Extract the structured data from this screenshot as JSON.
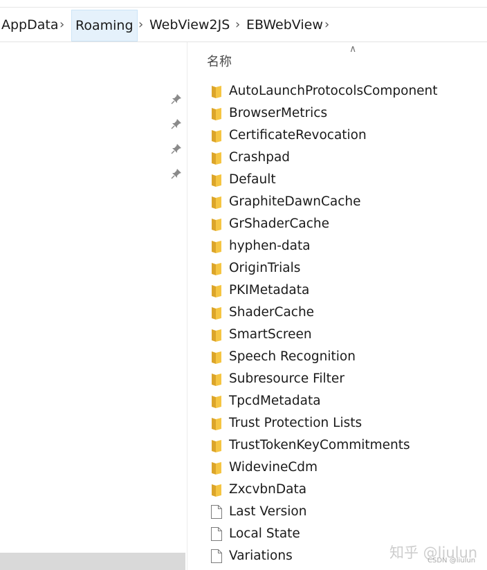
{
  "breadcrumb": {
    "items": [
      {
        "label": "AppData"
      },
      {
        "label": "Roaming"
      },
      {
        "label": "WebView2JS"
      },
      {
        "label": "EBWebView"
      }
    ],
    "separator_icon": "chevron-right-icon"
  },
  "nav_pane": {
    "pin_icon": "pin-icon",
    "pinned_count": 4
  },
  "content": {
    "sort_indicator_icon": "sort-ascending-icon",
    "column_header": "名称",
    "items": [
      {
        "name": "AutoLaunchProtocolsComponent",
        "type": "folder"
      },
      {
        "name": "BrowserMetrics",
        "type": "folder"
      },
      {
        "name": "CertificateRevocation",
        "type": "folder"
      },
      {
        "name": "Crashpad",
        "type": "folder"
      },
      {
        "name": "Default",
        "type": "folder"
      },
      {
        "name": "GraphiteDawnCache",
        "type": "folder"
      },
      {
        "name": "GrShaderCache",
        "type": "folder"
      },
      {
        "name": "hyphen-data",
        "type": "folder"
      },
      {
        "name": "OriginTrials",
        "type": "folder"
      },
      {
        "name": "PKIMetadata",
        "type": "folder"
      },
      {
        "name": "ShaderCache",
        "type": "folder"
      },
      {
        "name": "SmartScreen",
        "type": "folder"
      },
      {
        "name": "Speech Recognition",
        "type": "folder"
      },
      {
        "name": "Subresource Filter",
        "type": "folder"
      },
      {
        "name": "TpcdMetadata",
        "type": "folder"
      },
      {
        "name": "Trust Protection Lists",
        "type": "folder"
      },
      {
        "name": "TrustTokenKeyCommitments",
        "type": "folder"
      },
      {
        "name": "WidevineCdm",
        "type": "folder"
      },
      {
        "name": "ZxcvbnData",
        "type": "folder"
      },
      {
        "name": "Last Version",
        "type": "file"
      },
      {
        "name": "Local State",
        "type": "file"
      },
      {
        "name": "Variations",
        "type": "file"
      }
    ]
  },
  "watermark": {
    "main": "知乎 @liulun",
    "sub": "CSDN @liulun"
  },
  "colors": {
    "folder": "#f5c542",
    "folder_dark": "#dca52a",
    "active_crumb_bg": "#e5f1fb"
  }
}
